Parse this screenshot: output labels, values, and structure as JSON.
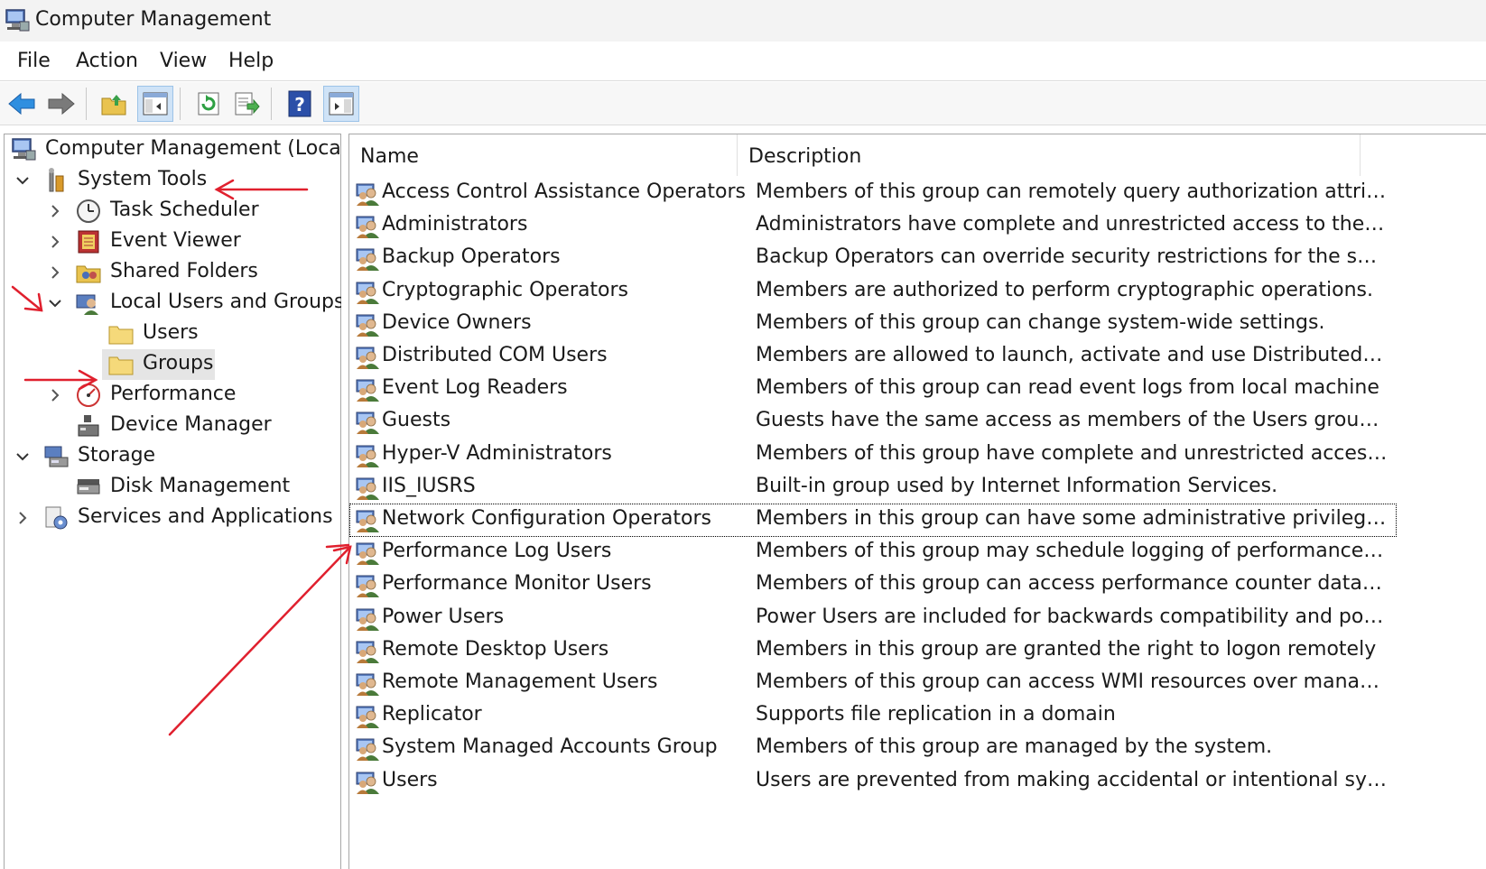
{
  "window": {
    "title": "Computer Management"
  },
  "menu": [
    "File",
    "Action",
    "View",
    "Help"
  ],
  "toolbar": {
    "buttons": [
      "back-arrow-icon",
      "forward-arrow-icon",
      "up-folder-icon",
      "show-hide-console-tree-icon",
      "refresh-icon",
      "export-list-icon",
      "help-icon",
      "show-hide-action-pane-icon"
    ]
  },
  "tree": {
    "root": "Computer Management (Local)",
    "system_tools": "System Tools",
    "task_scheduler": "Task Scheduler",
    "event_viewer": "Event Viewer",
    "shared_folders": "Shared Folders",
    "local_users_groups": "Local Users and Groups",
    "users": "Users",
    "groups": "Groups",
    "performance": "Performance",
    "device_manager": "Device Manager",
    "storage": "Storage",
    "disk_management": "Disk Management",
    "services_apps": "Services and Applications"
  },
  "list": {
    "columns": [
      "Name",
      "Description"
    ],
    "rows": [
      {
        "name": "Access Control Assistance Operators",
        "description": "Members of this group can remotely query authorization attribut..."
      },
      {
        "name": "Administrators",
        "description": "Administrators have complete and unrestricted access to the com..."
      },
      {
        "name": "Backup Operators",
        "description": "Backup Operators can override security restrictions for the sole pu..."
      },
      {
        "name": "Cryptographic Operators",
        "description": "Members are authorized to perform cryptographic operations."
      },
      {
        "name": "Device Owners",
        "description": "Members of this group can change system-wide settings."
      },
      {
        "name": "Distributed COM Users",
        "description": "Members are allowed to launch, activate and use Distributed CO..."
      },
      {
        "name": "Event Log Readers",
        "description": "Members of this group can read event logs from local machine"
      },
      {
        "name": "Guests",
        "description": "Guests have the same access as members of the Users group by d..."
      },
      {
        "name": "Hyper-V Administrators",
        "description": "Members of this group have complete and unrestricted access to ..."
      },
      {
        "name": "IIS_IUSRS",
        "description": "Built-in group used by Internet Information Services."
      },
      {
        "name": "Network Configuration Operators",
        "description": "Members in this group can have some administrative privileges t..."
      },
      {
        "name": "Performance Log Users",
        "description": "Members of this group may schedule logging of performance co..."
      },
      {
        "name": "Performance Monitor Users",
        "description": "Members of this group can access performance counter data local..."
      },
      {
        "name": "Power Users",
        "description": "Power Users are included for backwards compatibility and possess..."
      },
      {
        "name": "Remote Desktop Users",
        "description": "Members in this group are granted the right to logon remotely"
      },
      {
        "name": "Remote Management Users",
        "description": "Members of this group can access WMI resources over managem..."
      },
      {
        "name": "Replicator",
        "description": "Supports file replication in a domain"
      },
      {
        "name": "System Managed Accounts Group",
        "description": "Members of this group are managed by the system."
      },
      {
        "name": "Users",
        "description": "Users are prevented from making accidental or intentional system..."
      }
    ],
    "focused_row": "Network Configuration Operators"
  },
  "colors": {
    "annotation": "#e0202e",
    "selection": "#e5e5e5"
  }
}
